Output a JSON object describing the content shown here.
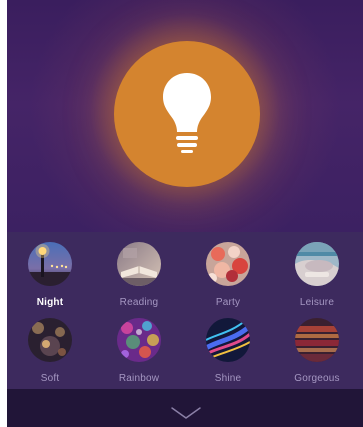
{
  "main": {
    "light_toggle": {
      "icon": "light-bulb-icon",
      "accent_color": "#d4842f"
    }
  },
  "scenes": [
    {
      "label": "Night",
      "active": true
    },
    {
      "label": "Reading",
      "active": false
    },
    {
      "label": "Party",
      "active": false
    },
    {
      "label": "Leisure",
      "active": false
    },
    {
      "label": "Soft",
      "active": false
    },
    {
      "label": "Rainbow",
      "active": false
    },
    {
      "label": "Shine",
      "active": false
    },
    {
      "label": "Gorgeous",
      "active": false
    }
  ],
  "footer": {
    "icon": "chevron-down-icon"
  }
}
